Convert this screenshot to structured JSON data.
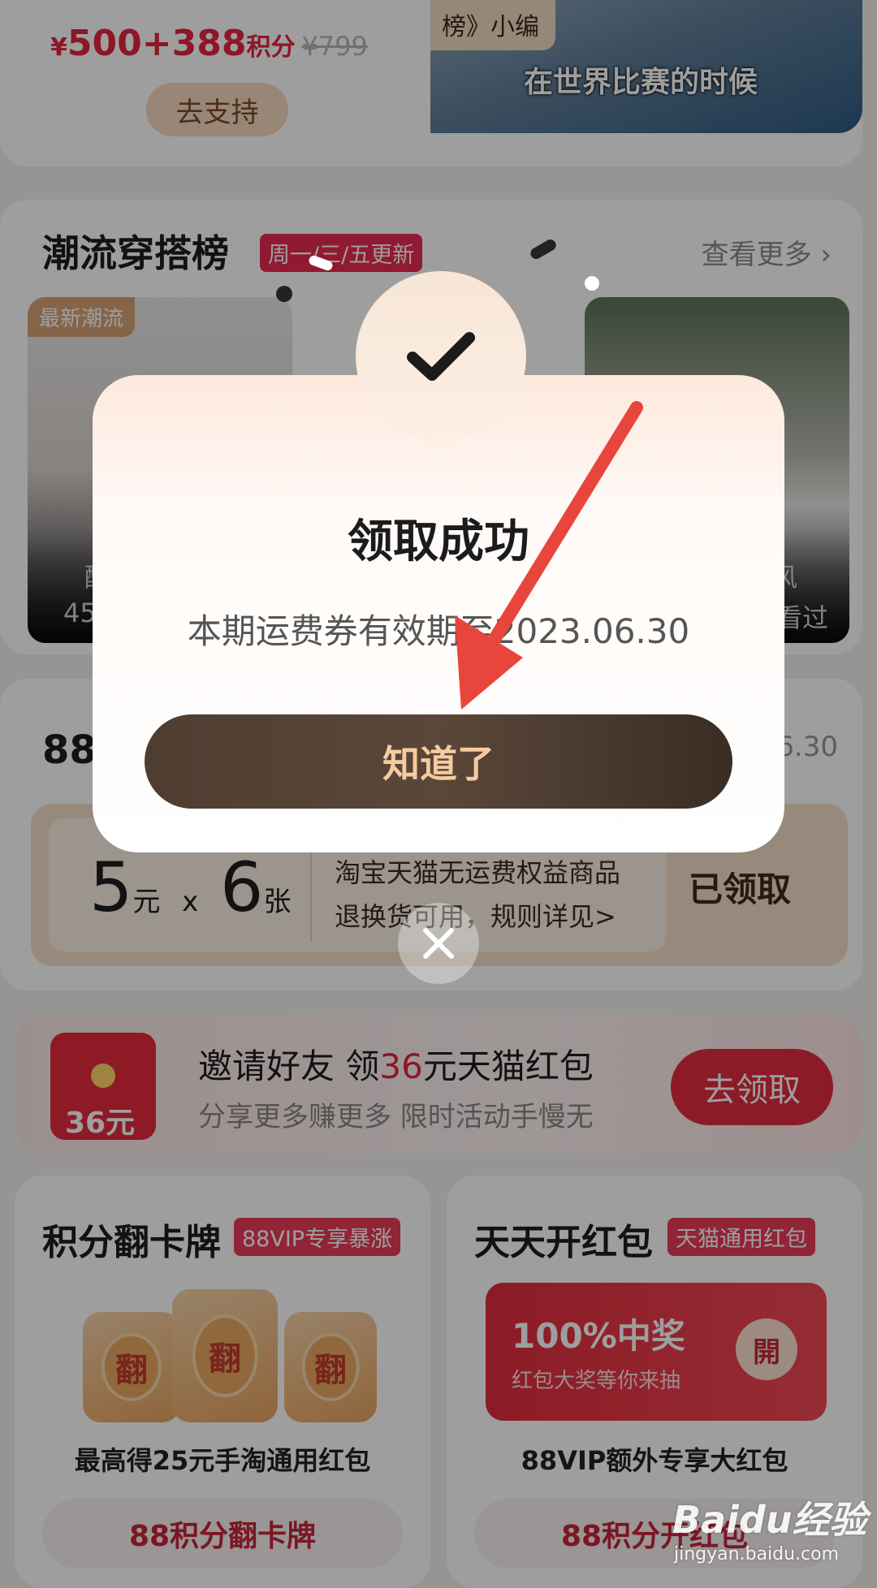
{
  "promo": {
    "currency": "¥",
    "price": "500",
    "plus": "+",
    "points": "388",
    "points_unit": "积分",
    "original_price": "¥799",
    "support_button": "去支持",
    "video_tag": "榜》小编",
    "video_caption": "在世界比赛的时候"
  },
  "fashion": {
    "title": "潮流穿搭榜",
    "badge": "周一/三/五更新",
    "see_more": "查看更多",
    "photo1_tag": "最新潮流",
    "photo1_text1": "酷",
    "photo1_text2": "45",
    "photo2_text1": "风",
    "photo2_text2": "看过"
  },
  "coupon": {
    "title": "88",
    "date": "6.30",
    "amount_value": "5",
    "amount_unit": "元",
    "times": "x",
    "count_value": "6",
    "count_unit": "张",
    "desc1": "淘宝天猫无运费权益商品",
    "desc2": "退换货可用，规则详见>",
    "claimed": "已领取"
  },
  "invite": {
    "title_pre": "邀请好友 领",
    "title_highlight": "36",
    "title_post": "元天猫红包",
    "subtitle": "分享更多赚更多 限时活动手慢无",
    "envelope_text": "36元",
    "button": "去领取"
  },
  "points_flip": {
    "title": "积分翻卡牌",
    "badge": "88VIP专享暴涨",
    "card_char": "翻",
    "desc": "最高得25元手淘通用红包",
    "action": "88积分翻卡牌"
  },
  "daily_redpack": {
    "title": "天天开红包",
    "badge": "天猫通用红包",
    "big": "100%中奖",
    "small": "红包大奖等你来抽",
    "open": "開",
    "desc": "88VIP额外专享大红包",
    "action": "88积分开红包"
  },
  "modal": {
    "title": "领取成功",
    "subtitle": "本期运费券有效期至2023.06.30",
    "button": "知道了"
  },
  "watermark": {
    "logo": "Baidu经验",
    "url": "jingyan.baidu.com"
  },
  "colors": {
    "brand_red": "#e5243f",
    "modal_button": "#4e3d30",
    "modal_button_text": "#f6cba0",
    "annotation_arrow": "#e8463c"
  }
}
